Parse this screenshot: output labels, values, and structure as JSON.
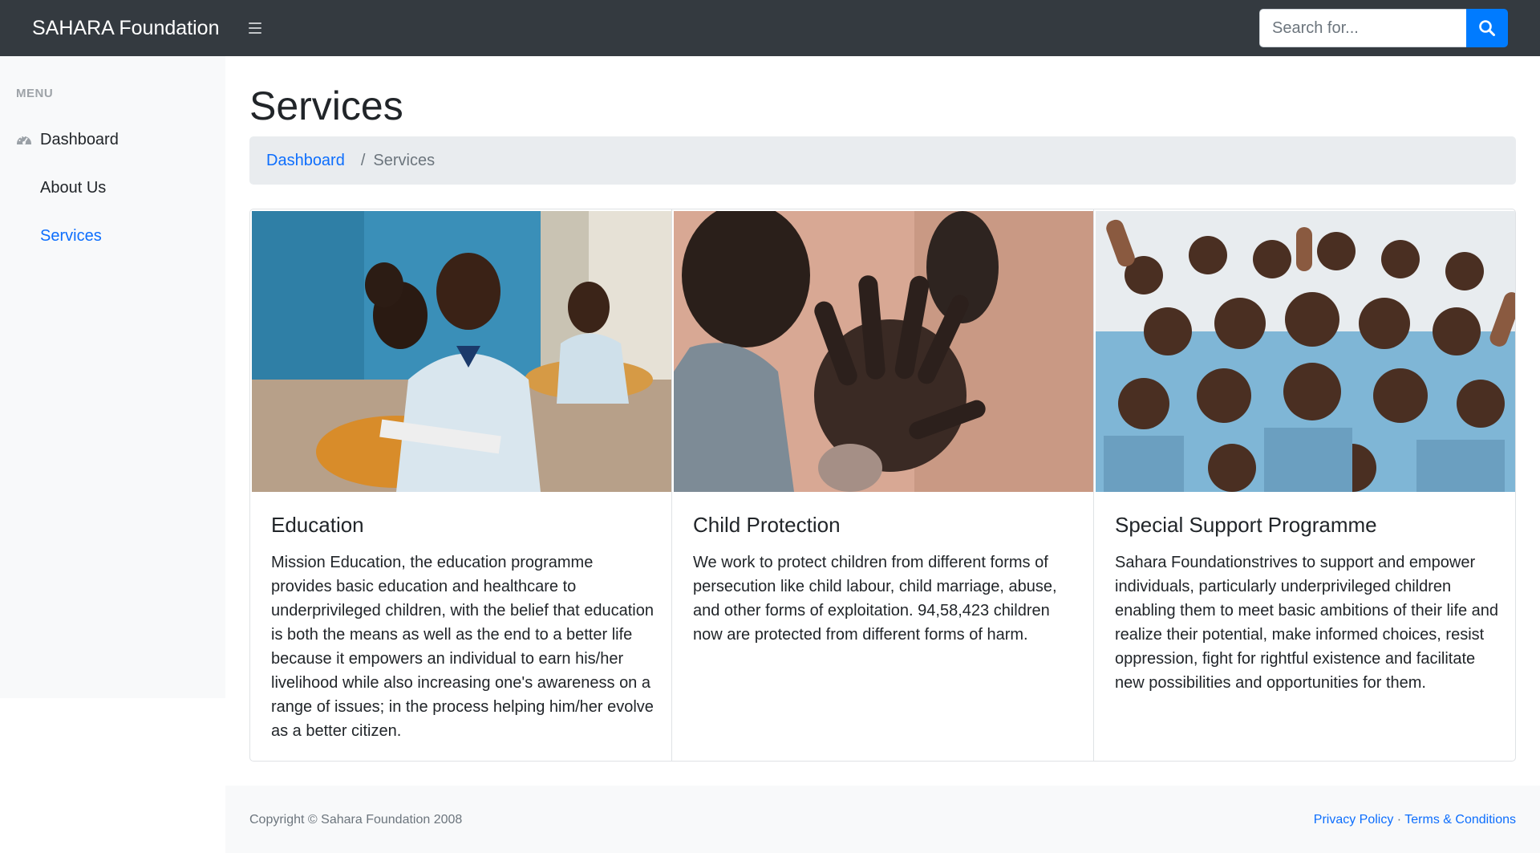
{
  "navbar": {
    "brand": "SAHARA Foundation",
    "search_placeholder": "Search for..."
  },
  "sidebar": {
    "heading": "MENU",
    "items": [
      {
        "label": "Dashboard",
        "icon": "dashboard-gauge-icon",
        "active": false
      },
      {
        "label": "About Us",
        "active": false
      },
      {
        "label": "Services",
        "active": true
      }
    ]
  },
  "main": {
    "title": "Services",
    "breadcrumb": {
      "link": "Dashboard",
      "separator": "/",
      "current": "Services"
    },
    "cards": [
      {
        "title": "Education",
        "text": "Mission Education, the education programme provides basic education and healthcare to underprivileged children, with the belief that education is both the means as well as the end to a better life because it empowers an individual to earn his/her livelihood while also increasing one's awareness on a range of issues; in the process helping him/her evolve as a better citizen."
      },
      {
        "title": "Child Protection",
        "text": "We work to protect children from different forms of persecution like child labour, child marriage, abuse, and other forms of exploitation. 94,58,423 children now are protected from different forms of harm."
      },
      {
        "title": "Special Support Programme",
        "text": "Sahara Foundationstrives to support and empower individuals, particularly underprivileged children enabling them to meet basic ambitions of their life and realize their potential, make informed choices, resist oppression, fight for rightful existence and facilitate new possibilities and opportunities for them."
      }
    ]
  },
  "footer": {
    "copyright": "Copyright © Sahara Foundation 2008",
    "privacy": "Privacy Policy",
    "separator": "·",
    "terms": "Terms & Conditions"
  },
  "colors": {
    "navbar_bg": "#343a40",
    "accent": "#007bff",
    "link": "#0d6efd",
    "sidebar_bg": "#f8f9fa",
    "breadcrumb_bg": "#e9ecef"
  }
}
